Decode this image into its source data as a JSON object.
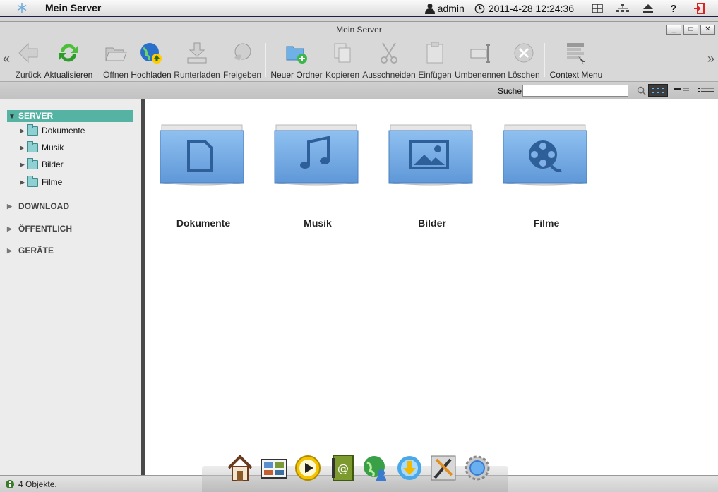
{
  "topbar": {
    "app_title": "Mein Server",
    "user": "admin",
    "datetime": "2011-4-28 12:24:36",
    "icons": [
      "snowflake-logo-icon",
      "user-icon",
      "clock-icon",
      "grid-icon",
      "network-icon",
      "eject-icon",
      "help-icon",
      "logout-icon"
    ]
  },
  "window": {
    "title": "Mein Server",
    "controls": [
      "_",
      "□",
      "✕"
    ]
  },
  "toolbar": {
    "nav_left": "«",
    "nav_right": "»",
    "items": [
      {
        "label": "Zurück",
        "icon": "back-arrow-icon"
      },
      {
        "label": "Aktualisieren",
        "icon": "refresh-icon"
      },
      {
        "label": "Öffnen",
        "icon": "open-folder-icon"
      },
      {
        "label": "Hochladen",
        "icon": "upload-globe-icon"
      },
      {
        "label": "Runterladen",
        "icon": "download-icon"
      },
      {
        "label": "Freigeben",
        "icon": "share-icon"
      },
      {
        "label": "Neuer Ordner",
        "icon": "new-folder-icon"
      },
      {
        "label": "Kopieren",
        "icon": "copy-icon"
      },
      {
        "label": "Ausschneiden",
        "icon": "scissors-icon"
      },
      {
        "label": "Einfügen",
        "icon": "paste-icon"
      },
      {
        "label": "Umbenennen",
        "icon": "rename-icon"
      },
      {
        "label": "Löschen",
        "icon": "delete-icon"
      },
      {
        "label": "Context Menu",
        "icon": "context-menu-icon"
      }
    ]
  },
  "search": {
    "label": "Suche",
    "value": "",
    "placeholder": ""
  },
  "sidebar": {
    "root": "SERVER",
    "children": [
      "Dokumente",
      "Musik",
      "Bilder",
      "Filme"
    ],
    "sections": [
      "DOWNLOAD",
      "ÖFFENTLICH",
      "GERÄTE"
    ]
  },
  "main": {
    "folders": [
      {
        "name": "Dokumente",
        "icon": "document-icon"
      },
      {
        "name": "Musik",
        "icon": "music-note-icon"
      },
      {
        "name": "Bilder",
        "icon": "picture-icon"
      },
      {
        "name": "Filme",
        "icon": "film-reel-icon"
      }
    ]
  },
  "status": {
    "text": "4 Objekte."
  },
  "dock": {
    "items": [
      "home-icon",
      "photo-album-icon",
      "media-player-icon",
      "address-book-icon",
      "web-user-icon",
      "download-station-icon",
      "tools-icon",
      "settings-gear-icon"
    ]
  },
  "colors": {
    "selected": "#55b3a4",
    "folder_blue": "#6fa6e0",
    "titlebar_border": "#1d1f4a"
  }
}
